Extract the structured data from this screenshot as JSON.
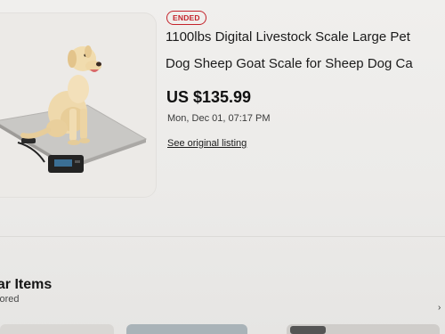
{
  "listing": {
    "status_badge": "ENDED",
    "title_line1": "1100lbs Digital Livestock Scale Large Pet",
    "title_line2": "Dog Sheep Goat Scale for Sheep Dog Ca",
    "price": "US $135.99",
    "date": "Mon, Dec 01, 07:17 PM",
    "see_original_link": "See original listing",
    "badge_color": "#c4232b"
  },
  "similar": {
    "title": "ilar Items",
    "subtitle": "sored"
  },
  "icons": {
    "product_image": "product-photo-dog-on-scale"
  }
}
